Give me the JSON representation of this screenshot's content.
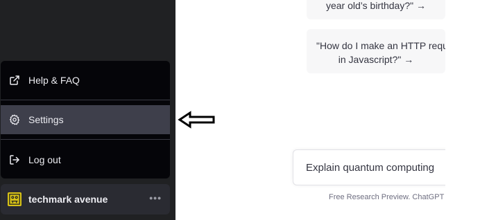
{
  "sidebar": {
    "menu": {
      "items": [
        {
          "label": "Help & FAQ",
          "icon": "external-link-icon"
        },
        {
          "label": "Settings",
          "icon": "gear-icon"
        },
        {
          "label": "Log out",
          "icon": "logout-icon"
        }
      ],
      "active_index": 1
    },
    "user": {
      "name": "techmark avenue",
      "more": "•••",
      "avatar_color": "#d8c316"
    }
  },
  "annotation": {
    "icon": "pointer-arrow-icon"
  },
  "main": {
    "examples": [
      "year old’s birthday?\" →",
      "\"How do I make an HTTP reque",
      "in Javascript?\" →"
    ],
    "composer": {
      "value": "Explain quantum computing"
    },
    "footer": "Free Research Preview. ChatGPT"
  },
  "colors": {
    "sidebar_bg": "#202123",
    "menu_bg": "#050509",
    "active_item_bg": "#3e3f4b",
    "card_bg": "#f7f7f8"
  }
}
